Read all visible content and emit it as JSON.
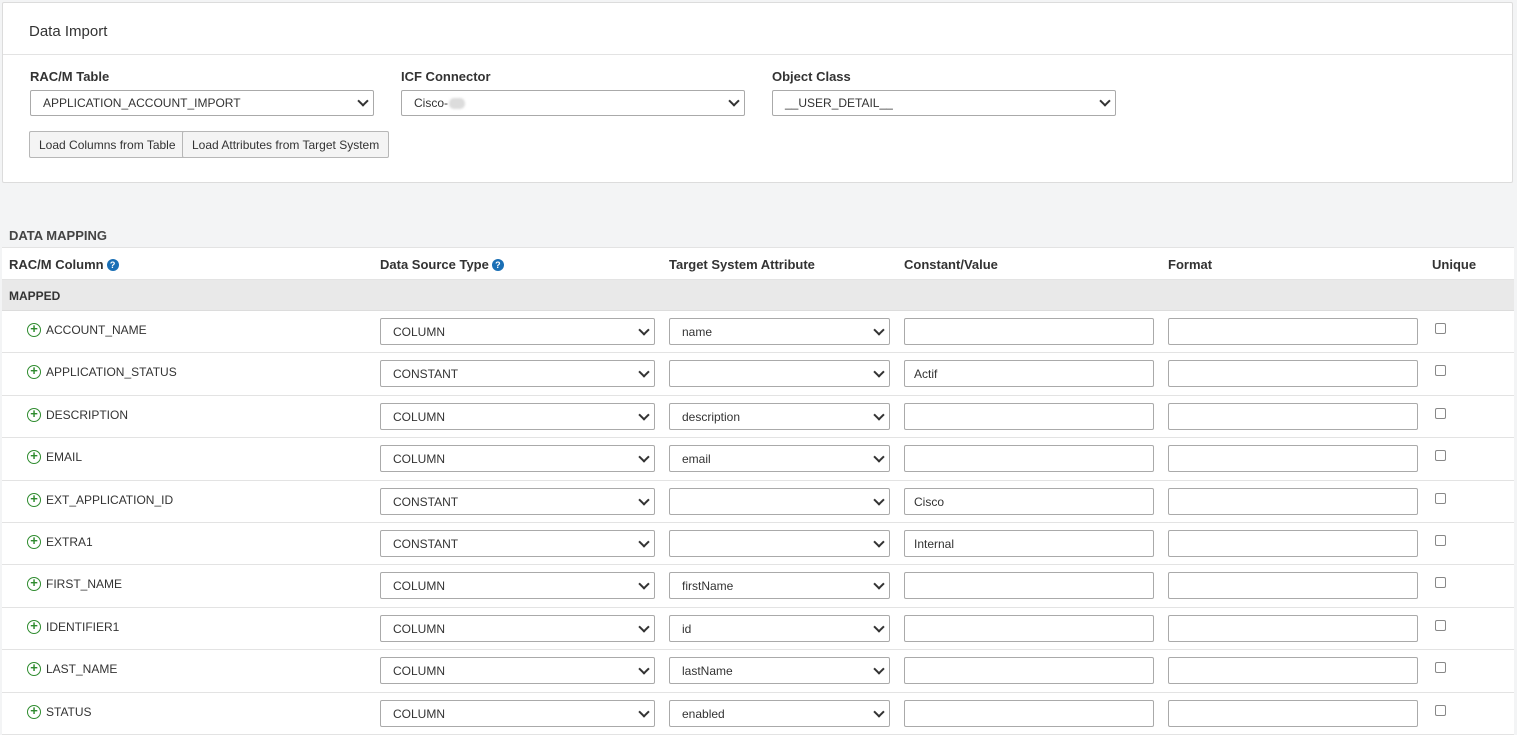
{
  "header": {
    "title": "Data Import"
  },
  "fields": {
    "table": {
      "label": "RAC/M Table",
      "value": "APPLICATION_ACCOUNT_IMPORT"
    },
    "connector": {
      "label": "ICF Connector",
      "value": "Cisco-"
    },
    "object_class": {
      "label": "Object Class",
      "value": "__USER_DETAIL__"
    }
  },
  "buttons": {
    "load_columns": "Load Columns from Table",
    "load_attributes": "Load Attributes from Target System"
  },
  "mapping": {
    "title": "DATA MAPPING",
    "columns": {
      "racm_column": "RAC/M Column",
      "data_source_type": "Data Source Type",
      "target_attribute": "Target System Attribute",
      "constant_value": "Constant/Value",
      "format": "Format",
      "unique": "Unique"
    },
    "group_label": "MAPPED",
    "rows": [
      {
        "name": "ACCOUNT_NAME",
        "source": "COLUMN",
        "target": "name",
        "constant": "",
        "format": "",
        "unique": false
      },
      {
        "name": "APPLICATION_STATUS",
        "source": "CONSTANT",
        "target": "",
        "constant": "Actif",
        "format": "",
        "unique": false
      },
      {
        "name": "DESCRIPTION",
        "source": "COLUMN",
        "target": "description",
        "constant": "",
        "format": "",
        "unique": false
      },
      {
        "name": "EMAIL",
        "source": "COLUMN",
        "target": "email",
        "constant": "",
        "format": "",
        "unique": false
      },
      {
        "name": "EXT_APPLICATION_ID",
        "source": "CONSTANT",
        "target": "",
        "constant": "Cisco",
        "format": "",
        "unique": false
      },
      {
        "name": "EXTRA1",
        "source": "CONSTANT",
        "target": "",
        "constant": "Internal",
        "format": "",
        "unique": false
      },
      {
        "name": "FIRST_NAME",
        "source": "COLUMN",
        "target": "firstName",
        "constant": "",
        "format": "",
        "unique": false
      },
      {
        "name": "IDENTIFIER1",
        "source": "COLUMN",
        "target": "id",
        "constant": "",
        "format": "",
        "unique": false
      },
      {
        "name": "LAST_NAME",
        "source": "COLUMN",
        "target": "lastName",
        "constant": "",
        "format": "",
        "unique": false
      },
      {
        "name": "STATUS",
        "source": "COLUMN",
        "target": "enabled",
        "constant": "",
        "format": "",
        "unique": false
      }
    ]
  },
  "icons": {
    "help": "question-circle-icon",
    "add": "plus-circle-icon",
    "dropdown": "chevron-down-icon"
  },
  "colors": {
    "help_icon": "#1a6fb5",
    "add_icon": "#2e8b2e"
  }
}
